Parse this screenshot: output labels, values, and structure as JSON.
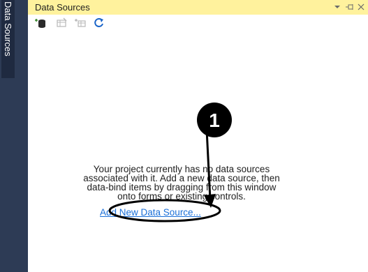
{
  "side_tab": {
    "label": "Data Sources"
  },
  "panel": {
    "title": "Data Sources",
    "title_buttons": [
      "dropdown-icon",
      "pin-icon",
      "close-icon"
    ],
    "toolbar": [
      "add-data-source-icon",
      "edit-dataset-icon",
      "configure-dataset-icon",
      "refresh-icon"
    ],
    "message_lines": [
      "Your project currently has no data sources",
      "associated with it. Add a new data source, then",
      "data-bind items by dragging from this window",
      "onto forms or existing controls."
    ],
    "link": "Add New Data Source..."
  },
  "annotation": {
    "badge_number": "1",
    "badge_color": "#000000",
    "accent": "#fff29d"
  }
}
